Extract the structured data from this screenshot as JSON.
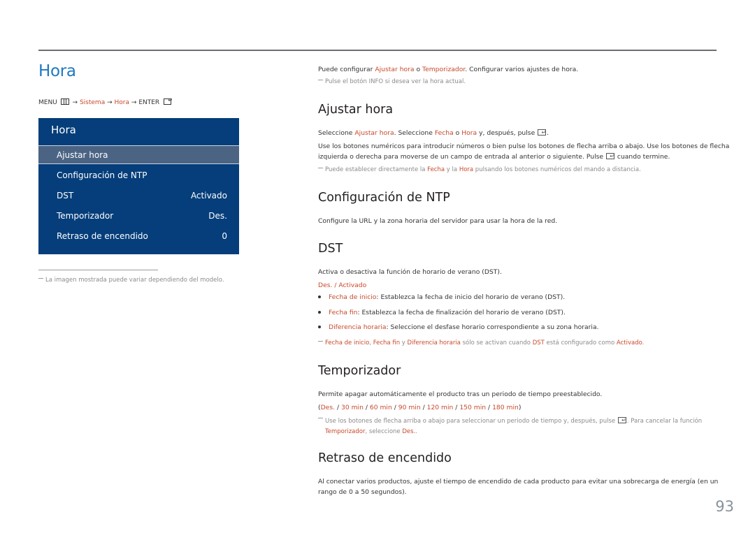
{
  "page": {
    "title": "Hora",
    "page_number": "93"
  },
  "breadcrumb": {
    "menu": "MENU",
    "arrow": "→",
    "sistema": "Sistema",
    "hora": "Hora",
    "enter": "ENTER"
  },
  "osd": {
    "title": "Hora",
    "items": [
      {
        "label": "Ajustar hora",
        "value": "",
        "selected": true
      },
      {
        "label": "Configuración de NTP",
        "value": ""
      },
      {
        "label": "DST",
        "value": "Activado"
      },
      {
        "label": "Temporizador",
        "value": "Des."
      },
      {
        "label": "Retraso de encendido",
        "value": "0"
      }
    ]
  },
  "left_note": "La imagen mostrada puede variar dependiendo del modelo.",
  "intro": {
    "p1_a": "Puede configurar ",
    "p1_link1": "Ajustar hora",
    "p1_b": " o ",
    "p1_link2": "Temporizador",
    "p1_c": ". Configurar varios ajustes de hora.",
    "note": "Pulse el botón INFO si desea ver la hora actual."
  },
  "sections": {
    "ajustar": {
      "heading": "Ajustar hora",
      "p1_a": "Seleccione ",
      "p1_l1": "Ajustar hora",
      "p1_b": ". Seleccione ",
      "p1_l2": "Fecha",
      "p1_c": " o ",
      "p1_l3": "Hora",
      "p1_d": " y, después, pulse ",
      "p1_e": ".",
      "p2_line1": "Use los botones numéricos para introducir números o bien pulse los botones de flecha arriba o abajo. Use los botones de flecha",
      "p2_line2_a": "izquierda o derecha para moverse de un campo de entrada al anterior o siguiente. Pulse ",
      "p2_line2_b": " cuando termine.",
      "note_a": "Puede establecer directamente la ",
      "note_l1": "Fecha",
      "note_b": " y la ",
      "note_l2": "Hora",
      "note_c": " pulsando los botones numéricos del mando a distancia."
    },
    "ntp": {
      "heading": "Configuración de NTP",
      "p1": "Configure la URL y la zona horaria del servidor para usar la hora de la red."
    },
    "dst": {
      "heading": "DST",
      "p1": "Activa o desactiva la función de horario de verano (DST).",
      "opt1": "Des.",
      "sep": " / ",
      "opt2": "Activado",
      "bullets": [
        {
          "term": "Fecha de inicio",
          "text": ": Establezca la fecha de inicio del horario de verano (DST)."
        },
        {
          "term": "Fecha fin",
          "text": ": Establezca la fecha de finalización del horario de verano (DST)."
        },
        {
          "term": "Diferencia horaria",
          "text": ": Seleccione el desfase horario correspondiente a su zona horaria."
        }
      ],
      "note_l1": "Fecha de inicio",
      "note_a": ", ",
      "note_l2": "Fecha fin",
      "note_b": " y ",
      "note_l3": "Diferencia horaria",
      "note_c": " sólo se activan cuando ",
      "note_l4": "DST",
      "note_d": " está configurado como ",
      "note_l5": "Activado",
      "note_e": "."
    },
    "temporizador": {
      "heading": "Temporizador",
      "p1": "Permite apagar automáticamente el producto tras un periodo de tiempo preestablecido.",
      "options": [
        "Des.",
        "30 min",
        "60 min",
        "90 min",
        "120 min",
        "150 min",
        "180 min"
      ],
      "note_line1_a": "Use los botones de flecha arriba o abajo para seleccionar un periodo de tiempo y, después, pulse ",
      "note_line1_b": ". Para cancelar la función",
      "note_l1": "Temporizador",
      "note_line2_a": ", seleccione ",
      "note_l2": "Des.",
      "note_line2_b": "."
    },
    "retraso": {
      "heading": "Retraso de encendido",
      "p1_line1": "Al conectar varios productos, ajuste el tiempo de encendido de cada producto para evitar una sobrecarga de energía (en un",
      "p1_line2": "rango de 0 a 50 segundos)."
    }
  }
}
